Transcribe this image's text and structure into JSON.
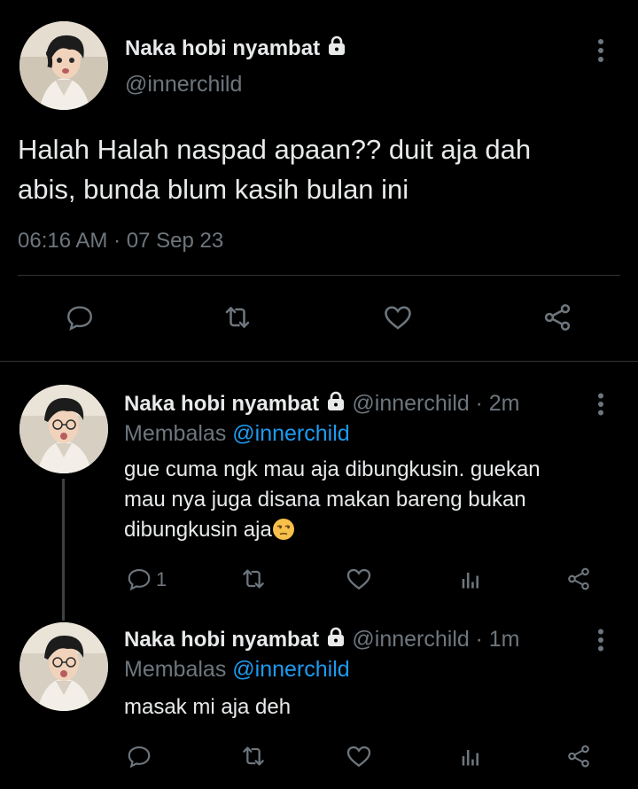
{
  "main_tweet": {
    "name": "Naka hobi nyambat",
    "handle": "@innerchild",
    "text_line1": "Halah Halah naspad apaan?? duit aja dah",
    "text_line2": "abis, bunda blum kasih bulan ini",
    "timestamp": "06:16 AM · 07 Sep 23",
    "actions": [
      "reply-icon",
      "retweet-icon",
      "like-icon",
      "share-icon"
    ]
  },
  "replies": [
    {
      "name": "Naka hobi nyambat",
      "handle": "@innerchild",
      "time": "· 2m",
      "replying_prefix": "Membalas",
      "replying_to": "@innerchild",
      "line1": "gue cuma ngk mau aja dibungkusin. guekan",
      "line2": "mau nya juga disana makan bareng bukan",
      "line3": "dibungkusin aja",
      "emoji": "unamused-face",
      "reply_count": "1"
    },
    {
      "name": "Naka hobi nyambat",
      "handle": "@innerchild",
      "time": "· 1m",
      "replying_prefix": "Membalas",
      "replying_to": "@innerchild",
      "line1": "masak mi aja deh"
    }
  ],
  "colors": {
    "background": "#000000",
    "text": "#e7e9ea",
    "muted": "#6e767d",
    "link": "#1d9bf0",
    "divider": "#2f3336"
  }
}
